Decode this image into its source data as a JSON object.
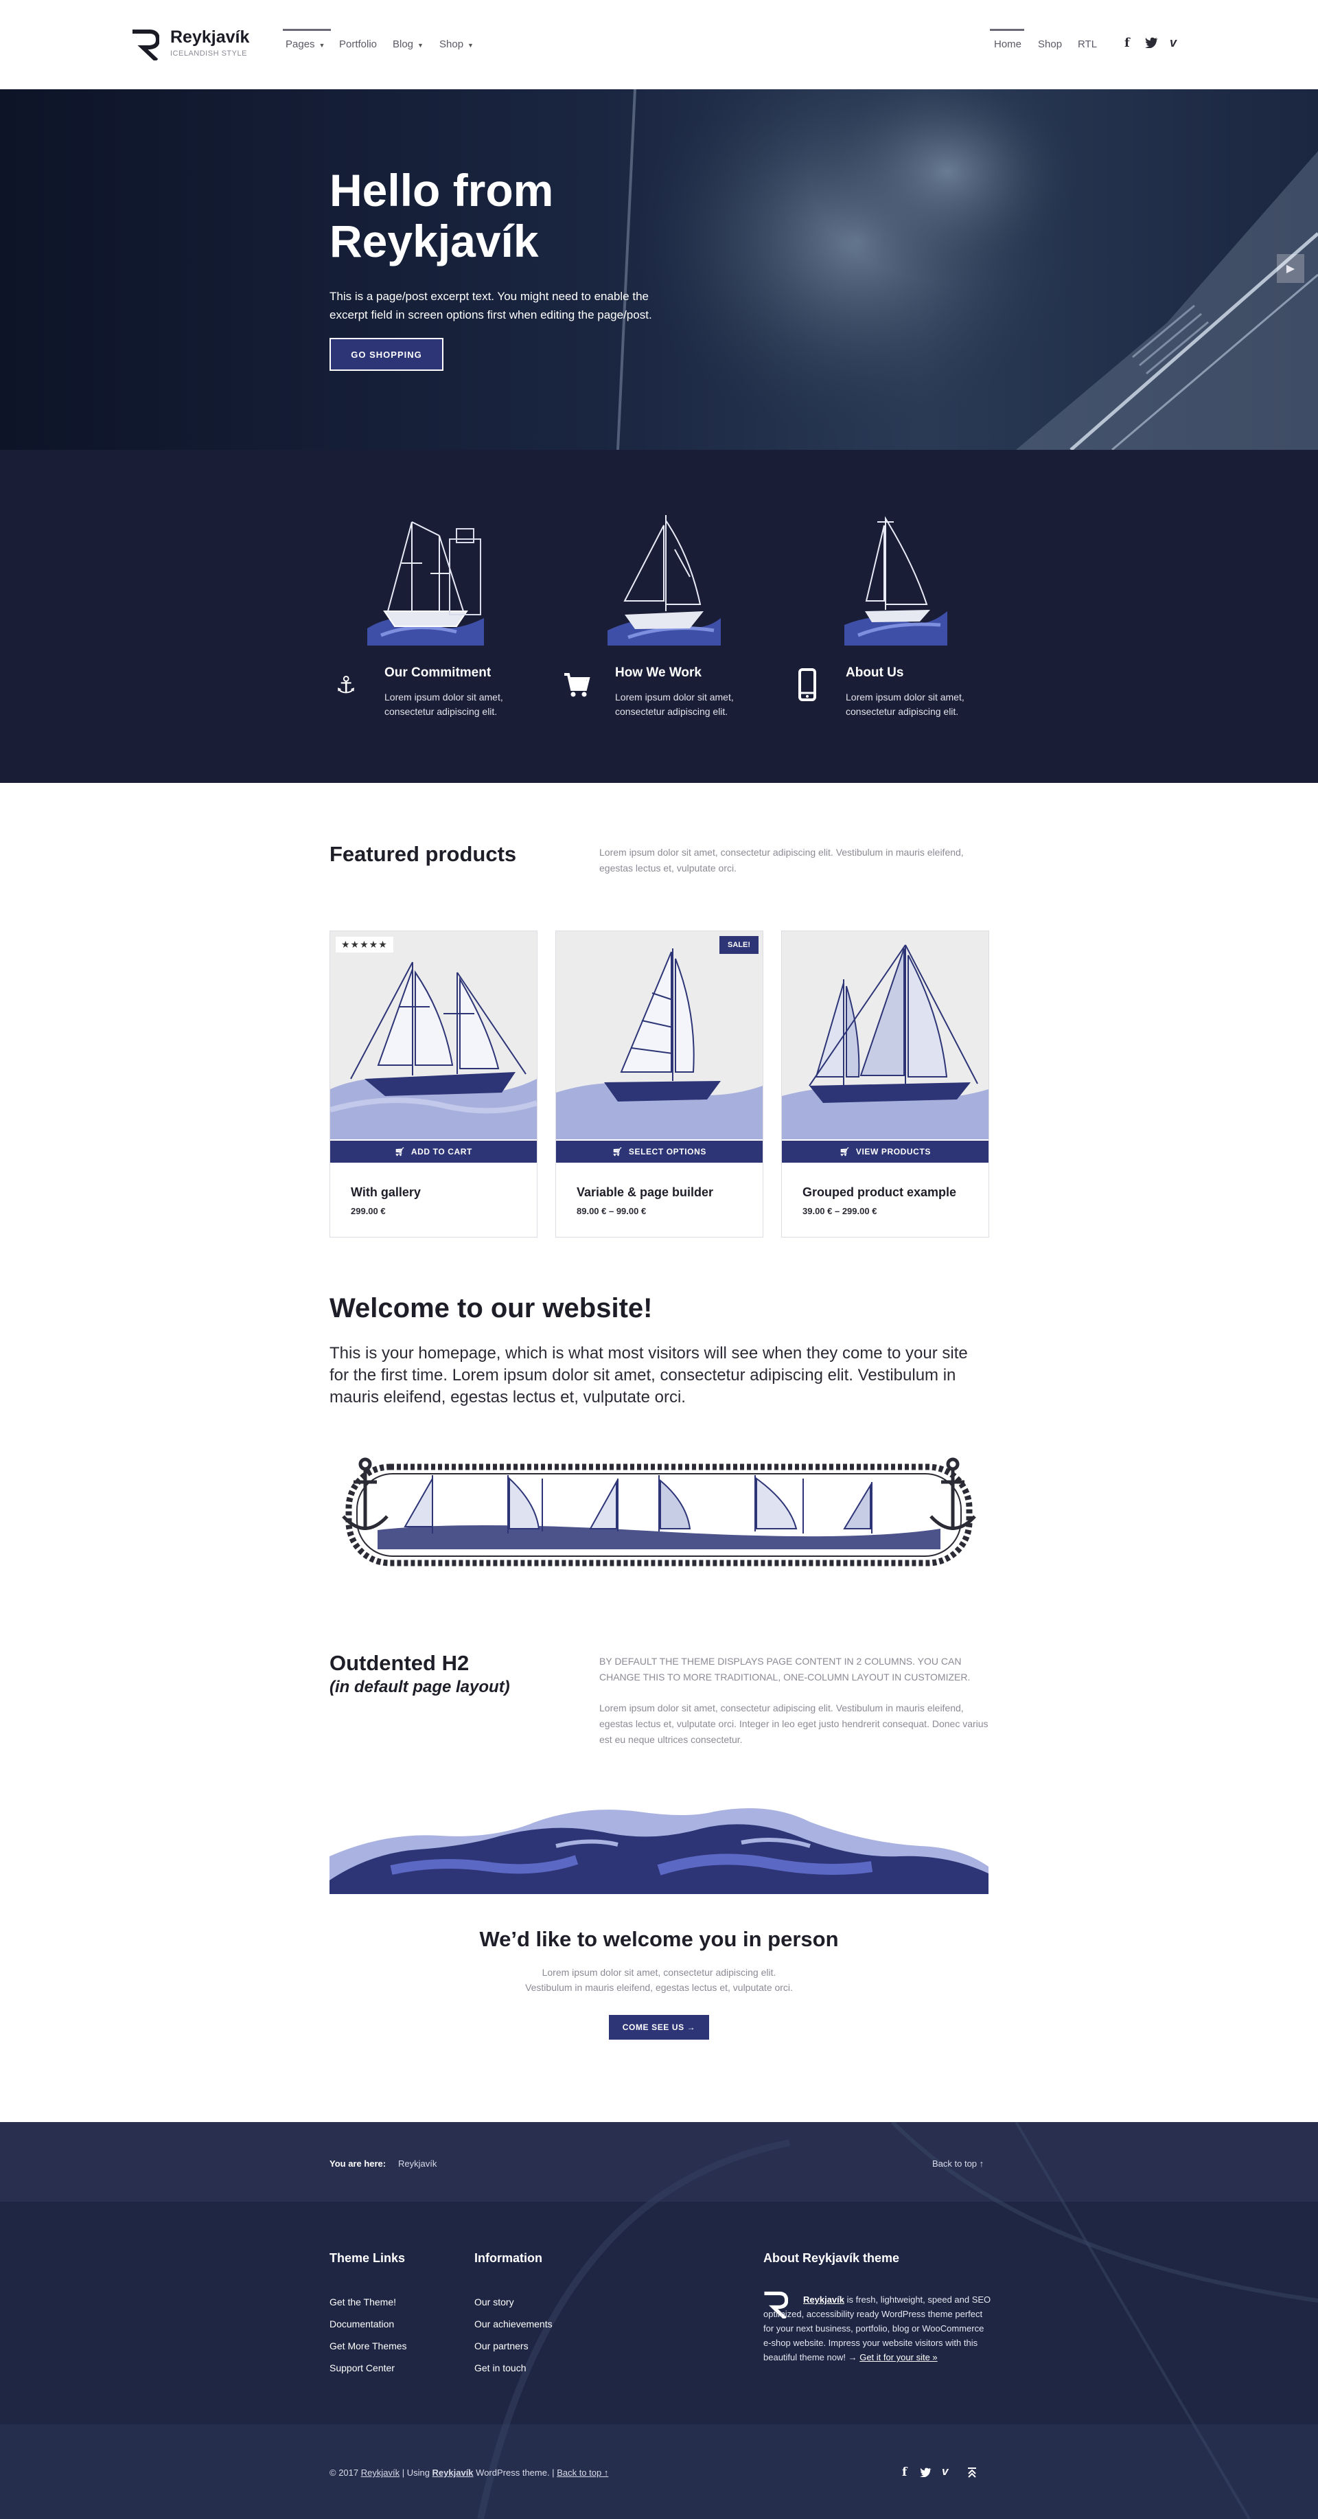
{
  "header": {
    "brand_title": "Reykjavík",
    "brand_tagline": "ICELANDISH STYLE",
    "nav_left": [
      {
        "label": "Pages",
        "has_caret": true
      },
      {
        "label": "Portfolio",
        "has_caret": false
      },
      {
        "label": "Blog",
        "has_caret": true
      },
      {
        "label": "Shop",
        "has_caret": true
      }
    ],
    "nav_right": [
      {
        "label": "Home"
      },
      {
        "label": "Shop"
      },
      {
        "label": "RTL"
      }
    ],
    "social_icons": [
      "facebook-icon",
      "twitter-icon",
      "vimeo-icon"
    ]
  },
  "hero": {
    "title": "Hello from Reykjavík",
    "text": "This is a page/post excerpt text. You might need to enable the excerpt field in screen options first when editing the page/post.",
    "button": "GO SHOPPING"
  },
  "features": [
    {
      "icon": "anchor-icon",
      "title": "Our Commitment",
      "text": "Lorem ipsum dolor sit amet, consectetur adipiscing elit."
    },
    {
      "icon": "cart-icon",
      "title": "How We Work",
      "text": "Lorem ipsum dolor sit amet, consectetur adipiscing elit."
    },
    {
      "icon": "mobile-icon",
      "title": "About Us",
      "text": "Lorem ipsum dolor sit amet, consectetur adipiscing elit."
    }
  ],
  "featured": {
    "title": "Featured products",
    "text": "Lorem ipsum dolor sit amet, consectetur adipiscing elit. Vestibulum in mauris eleifend, egestas lectus et, vulputate orci."
  },
  "products": [
    {
      "name": "With gallery",
      "price": "299.00 €",
      "button": "ADD TO CART",
      "badge": "★★★★★"
    },
    {
      "name": "Variable & page builder",
      "price": "89.00 € – 99.00 €",
      "button": "SELECT OPTIONS",
      "badge": "SALE!"
    },
    {
      "name": "Grouped product example",
      "price": "39.00 € – 299.00 €",
      "button": "VIEW PRODUCTS",
      "badge": ""
    }
  ],
  "welcome": {
    "title": "Welcome to our website!",
    "text": "This is your homepage, which is what most visitors will see when they come to your site for the first time. Lorem ipsum dolor sit amet, consectetur adipiscing elit. Vestibulum in mauris eleifend, egestas lectus et, vulputate orci."
  },
  "outdented": {
    "title": "Outdented H2",
    "subtitle": "(in default page layout)",
    "caps_text": "BY DEFAULT THE THEME DISPLAYS PAGE CONTENT IN 2 COLUMNS. YOU CAN CHANGE THIS TO MORE TRADITIONAL, ONE-COLUMN LAYOUT IN CUSTOMIZER.",
    "body_text": "Lorem ipsum dolor sit amet, consectetur adipiscing elit. Vestibulum in mauris eleifend, egestas lectus et, vulputate orci. Integer in leo eget justo hendrerit consequat. Donec varius est eu neque ultrices consectetur."
  },
  "person": {
    "title": "We’d like to welcome you in person",
    "line1": "Lorem ipsum dolor sit amet, consectetur adipiscing elit.",
    "line2": "Vestibulum in mauris eleifend, egestas lectus et, vulputate orci.",
    "button": "COME SEE US →"
  },
  "footer": {
    "breadcrumb_label": "You are here:",
    "breadcrumb_value": "Reykjavík",
    "back_to_top": "Back to top ↑",
    "col1_title": "Theme Links",
    "col1_links": [
      "Get the Theme!",
      "Documentation",
      "Get More Themes",
      "Support Center"
    ],
    "col2_title": "Information",
    "col2_links": [
      "Our story",
      "Our achievements",
      "Our partners",
      "Get in touch"
    ],
    "col3_title": "About Reykjavík theme",
    "about_link": "Reykjavík",
    "about_text": " is fresh, lightweight, speed and SEO optimized, accessibility ready WordPress theme perfect for your next business, portfolio, blog or WooCommerce e-shop website. Impress your website visitors with this beautiful theme now! → ",
    "about_cta": "Get it for your site »",
    "copyright_prefix": "© 2017 ",
    "copyright_site": "Reykjavík",
    "copyright_mid": " | Using ",
    "copyright_theme": "Reykjavík",
    "copyright_wp": " WordPress",
    "copyright_suffix": " theme. | ",
    "copyright_back": "Back to top ↑",
    "social_icons": [
      "facebook-icon",
      "twitter-icon",
      "vimeo-icon",
      "back-to-top-icon"
    ]
  },
  "colors": {
    "accent": "#2d3577",
    "dark_band": "#1a1d36",
    "footer_bg": "#1f2643",
    "wave_light": "#a9b2e0",
    "wave_dark": "#2d3577"
  }
}
